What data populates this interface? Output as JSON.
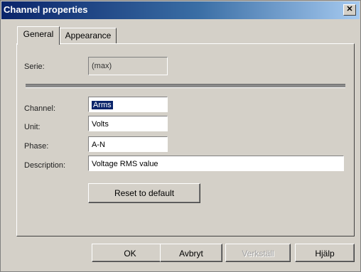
{
  "window": {
    "title": "Channel properties",
    "close_glyph": "✕"
  },
  "tabs": [
    {
      "label": "General"
    },
    {
      "label": "Appearance"
    }
  ],
  "general": {
    "serie_label": "Serie:",
    "serie_value": "(max)",
    "channel_label": "Channel:",
    "channel_value": "Arms",
    "unit_label": "Unit:",
    "unit_value": "Volts",
    "phase_label": "Phase:",
    "phase_value": "A-N",
    "description_label": "Description:",
    "description_value": "Voltage RMS value",
    "reset_label": "Reset to default"
  },
  "buttons": {
    "ok": "OK",
    "cancel": "Avbryt",
    "apply": "Verkställ",
    "help": "Hjälp"
  }
}
